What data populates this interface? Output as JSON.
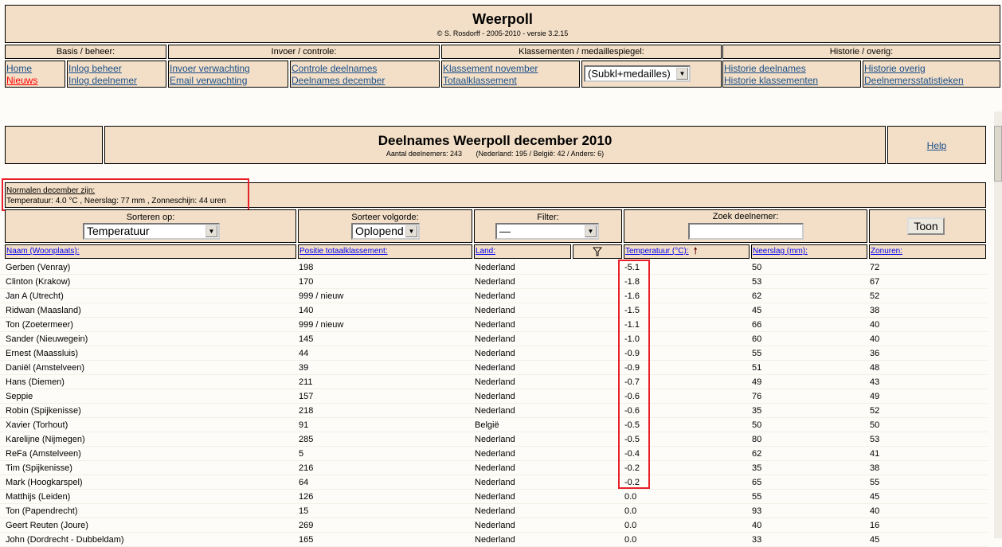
{
  "header": {
    "title": "Weerpoll",
    "subtitle": "© S. Rosdorff - 2005-2010 - versie 3.2.15"
  },
  "nav": {
    "groups": [
      "Basis / beheer:",
      "Invoer / controle:",
      "Klassementen / medaillespiegel:",
      "Historie / overig:"
    ],
    "links": [
      [
        "Home",
        "Nieuws"
      ],
      [
        "Inlog beheer",
        "Inlog deelnemer"
      ],
      [
        "Invoer verwachting",
        "Email verwachting"
      ],
      [
        "Controle deelnames",
        "Deelnames december"
      ],
      [
        "Klassement november",
        "Totaalklassement"
      ],
      [
        "Historie deelnames",
        "Historie klassementen"
      ],
      [
        "Historie overig",
        "Deelnemersstatistieken"
      ]
    ],
    "select_value": "(Subkl+medailles)"
  },
  "page": {
    "title": "Deelnames Weerpoll december 2010",
    "count": "Aantal deelnemers: 243",
    "breakdown": "(Nederland: 195 / België: 42 / Anders: 6)",
    "help": "Help"
  },
  "normals": {
    "title": "Normalen december zijn:",
    "text": "Temperatuur: 4.0 °C , Neerslag: 77 mm , Zonneschijn: 44 uren"
  },
  "controls": {
    "sort_label": "Sorteren op:",
    "sort_value": "Temperatuur",
    "order_label": "Sorteer volgorde:",
    "order_value": "Oplopend",
    "filter_label": "Filter:",
    "filter_value": "—",
    "search_label": "Zoek deelnemer:",
    "search_value": "",
    "button": "Toon"
  },
  "columns": {
    "name": "Naam (Woonplaats):",
    "pos": "Positie totaalklassement:",
    "land": "Land:",
    "temp": "Temperatuur (°C):",
    "rain": "Neerslag (mm):",
    "sun": "Zonuren:"
  },
  "rows": [
    [
      "Gerben (Venray)",
      "198",
      "Nederland",
      "-5.1",
      "50",
      "72"
    ],
    [
      "Clinton (Krakow)",
      "170",
      "Nederland",
      "-1.8",
      "53",
      "67"
    ],
    [
      "Jan A (Utrecht)",
      "999 / nieuw",
      "Nederland",
      "-1.6",
      "62",
      "52"
    ],
    [
      "Ridwan (Maasland)",
      "140",
      "Nederland",
      "-1.5",
      "45",
      "38"
    ],
    [
      "Ton (Zoetermeer)",
      "999 / nieuw",
      "Nederland",
      "-1.1",
      "66",
      "40"
    ],
    [
      "Sander (Nieuwegein)",
      "145",
      "Nederland",
      "-1.0",
      "60",
      "40"
    ],
    [
      "Ernest (Maassluis)",
      "44",
      "Nederland",
      "-0.9",
      "55",
      "36"
    ],
    [
      "Daniël (Amstelveen)",
      "39",
      "Nederland",
      "-0.9",
      "51",
      "48"
    ],
    [
      "Hans (Diemen)",
      "211",
      "Nederland",
      "-0.7",
      "49",
      "43"
    ],
    [
      "Seppie",
      "157",
      "Nederland",
      "-0.6",
      "76",
      "49"
    ],
    [
      "Robin (Spijkenisse)",
      "218",
      "Nederland",
      "-0.6",
      "35",
      "52"
    ],
    [
      "Xavier (Torhout)",
      "91",
      "België",
      "-0.5",
      "50",
      "50"
    ],
    [
      "Karelijne (Nijmegen)",
      "285",
      "Nederland",
      "-0.5",
      "80",
      "53"
    ],
    [
      "ReFa (Amstelveen)",
      "5",
      "Nederland",
      "-0.4",
      "62",
      "41"
    ],
    [
      "Tim (Spijkenisse)",
      "216",
      "Nederland",
      "-0.2",
      "35",
      "38"
    ],
    [
      "Mark (Hoogkarspel)",
      "64",
      "Nederland",
      "-0.2",
      "65",
      "55"
    ],
    [
      "Matthijs (Leiden)",
      "126",
      "Nederland",
      "0.0",
      "55",
      "45"
    ],
    [
      "Ton (Papendrecht)",
      "15",
      "Nederland",
      "0.0",
      "93",
      "40"
    ],
    [
      "Geert Reuten (Joure)",
      "269",
      "Nederland",
      "0.0",
      "40",
      "16"
    ],
    [
      "John (Dordrecht - Dubbeldam)",
      "165",
      "Nederland",
      "0.0",
      "33",
      "45"
    ]
  ]
}
